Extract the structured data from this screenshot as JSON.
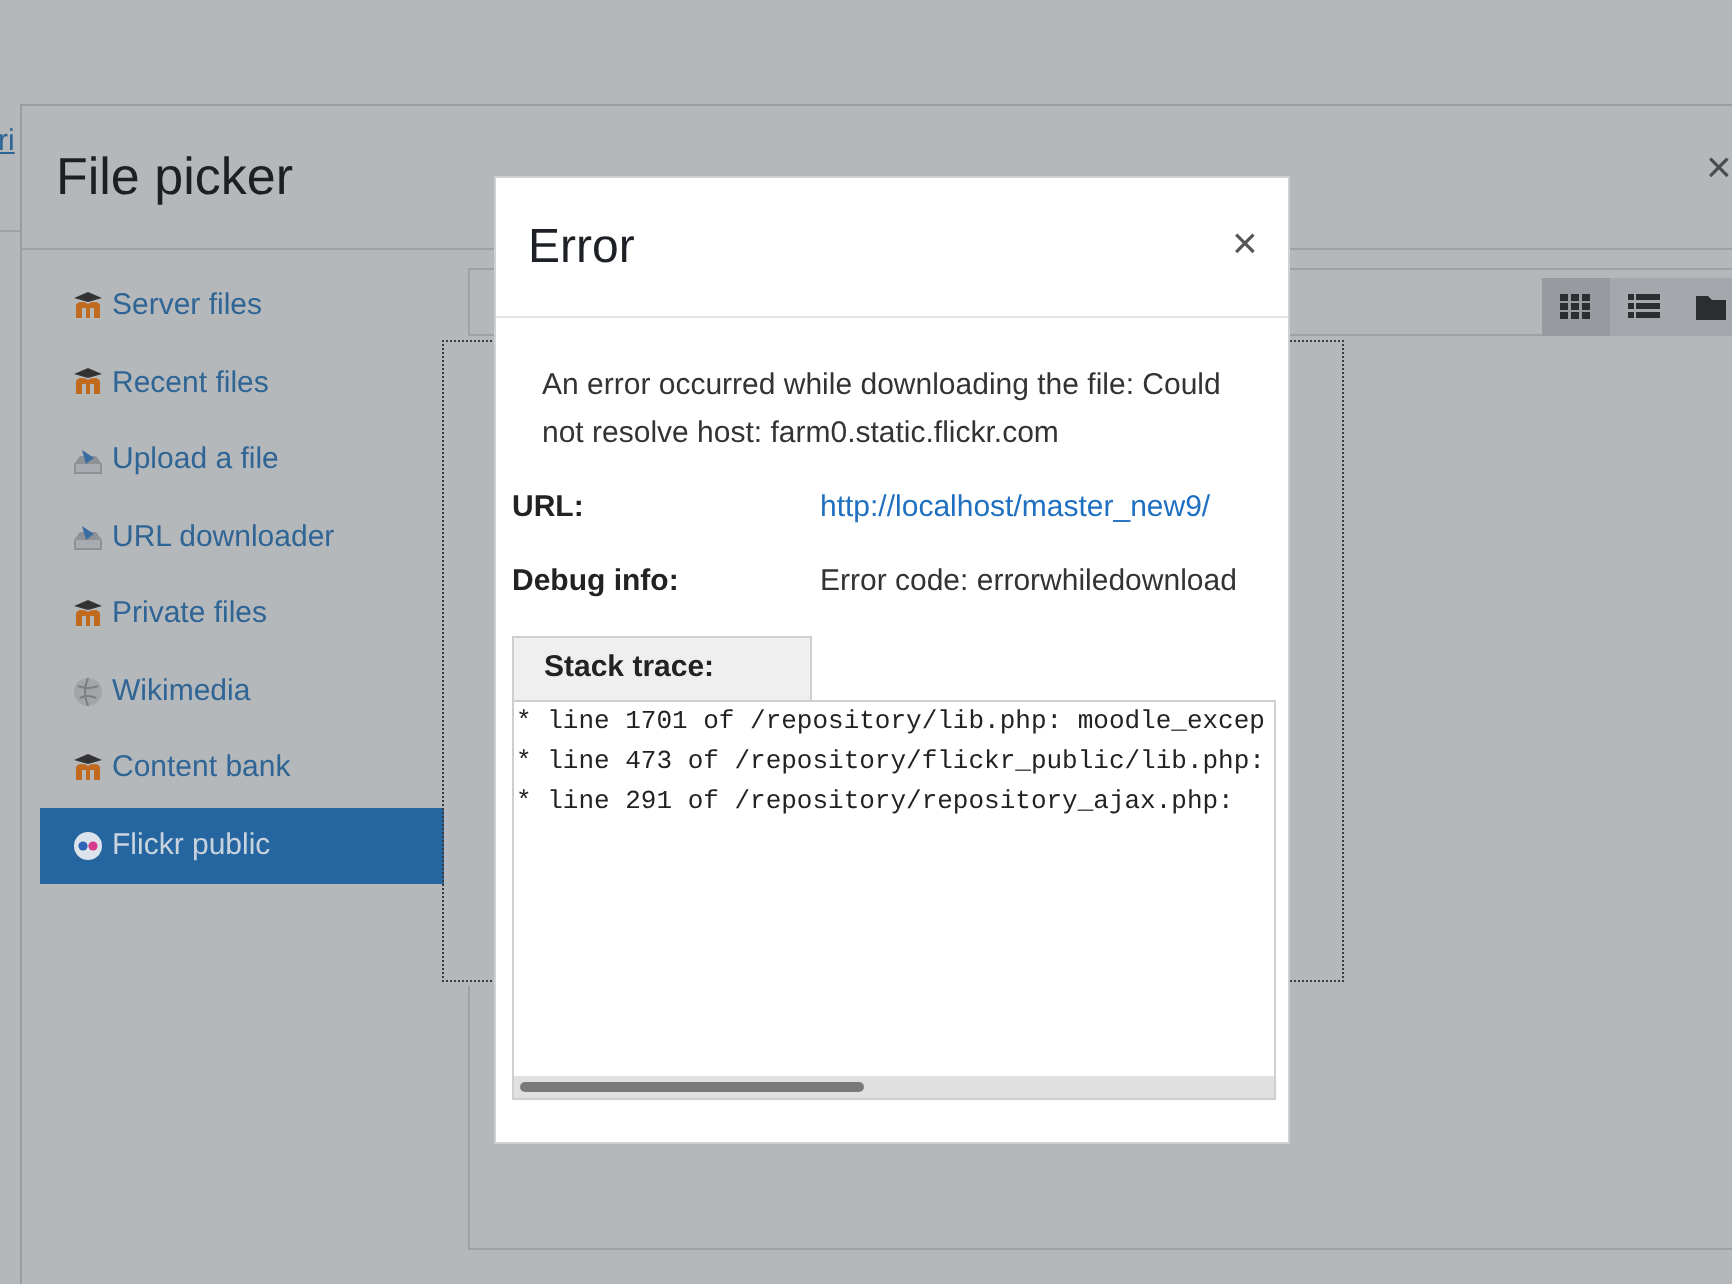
{
  "background": {
    "link_fragment": "ri"
  },
  "file_picker": {
    "title": "File picker",
    "close": "×",
    "repositories": [
      {
        "name": "Server files",
        "kind": "moodle",
        "selected": false
      },
      {
        "name": "Recent files",
        "kind": "moodle",
        "selected": false
      },
      {
        "name": "Upload a file",
        "kind": "upload",
        "selected": false
      },
      {
        "name": "URL downloader",
        "kind": "upload",
        "selected": false
      },
      {
        "name": "Private files",
        "kind": "moodle",
        "selected": false
      },
      {
        "name": "Wikimedia",
        "kind": "globe",
        "selected": false
      },
      {
        "name": "Content bank",
        "kind": "moodle",
        "selected": false
      },
      {
        "name": "Flickr public",
        "kind": "flickr",
        "selected": true
      }
    ],
    "view_buttons": [
      {
        "kind": "grid",
        "selected": true
      },
      {
        "kind": "list",
        "selected": false
      },
      {
        "kind": "folder",
        "selected": false
      }
    ]
  },
  "error_dialog": {
    "title": "Error",
    "close": "×",
    "message": "An error occurred while downloading the file: Could not resolve host: farm0.static.flickr.com",
    "details": [
      {
        "label": "URL:",
        "value": "http://localhost/master_new9/",
        "kind": "link"
      },
      {
        "label": "Debug info:",
        "value": "Error code: errorwhiledownload",
        "kind": "text"
      }
    ],
    "stack_trace": {
      "tab": "Stack trace:",
      "lines": [
        "* line 1701 of /repository/lib.php: moodle_excep",
        "* line 473 of /repository/flickr_public/lib.php:",
        "* line 291 of /repository/repository_ajax.php:"
      ]
    }
  }
}
